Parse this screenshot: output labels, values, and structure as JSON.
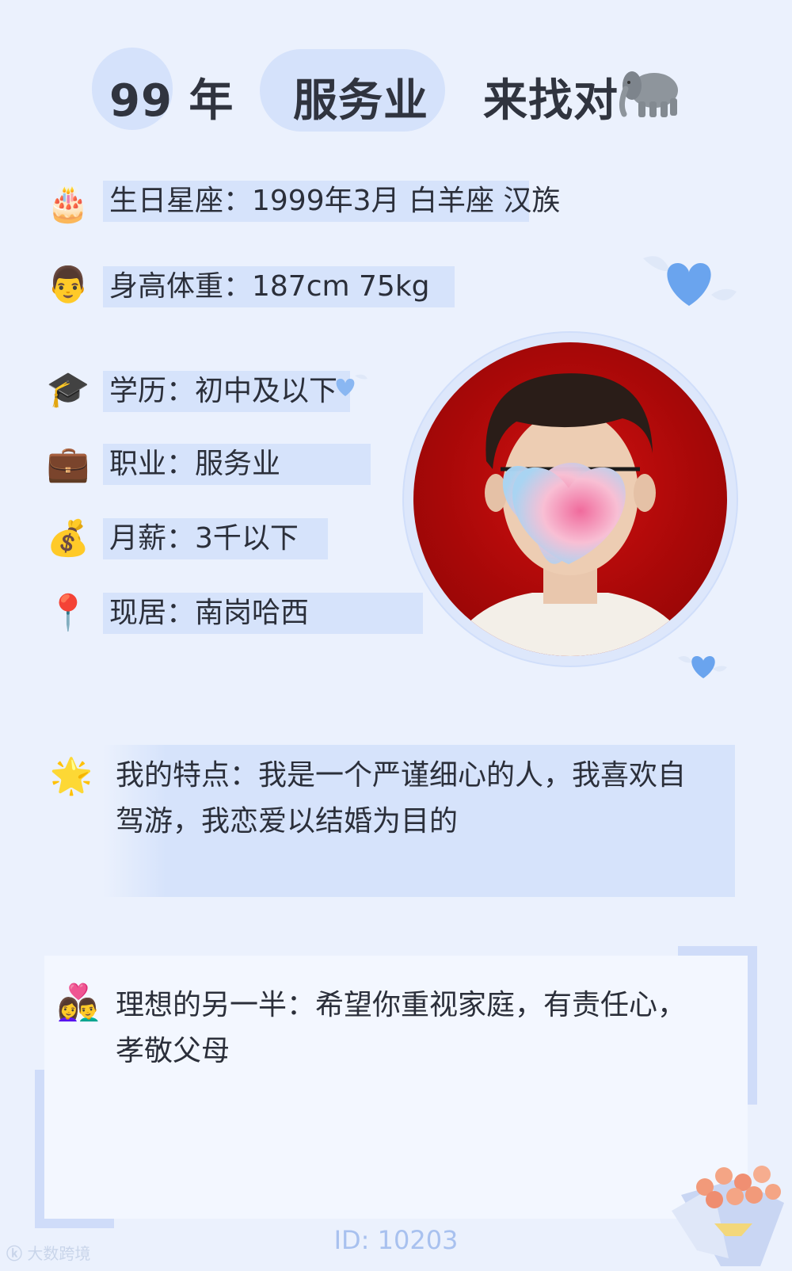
{
  "header": {
    "year": "99 年",
    "job": "服务业",
    "seeking": "来找对",
    "seeking_icon": "elephant-emoji"
  },
  "info": [
    {
      "icon": "🎂",
      "icon_name": "birthday-cake-icon",
      "label": "生日星座：1999年3月 白羊座 汉族"
    },
    {
      "icon": "👨",
      "icon_name": "man-face-icon",
      "label": "身高体重：187cm 75kg"
    },
    {
      "icon": "🎓",
      "icon_name": "graduation-cap-icon",
      "label": "学历：初中及以下"
    },
    {
      "icon": "💼",
      "icon_name": "briefcase-icon",
      "label": "职业：服务业"
    },
    {
      "icon": "💰",
      "icon_name": "money-bag-icon",
      "label": "月薪：3千以下"
    },
    {
      "icon": "📍",
      "icon_name": "location-pin-icon",
      "label": "现居：南岗哈西"
    }
  ],
  "traits": {
    "icon": "🌟",
    "line1": "我的特点：我是一个严谨细心的人，我喜欢自",
    "line2": "驾游，我恋爱以结婚为目的"
  },
  "ideal": {
    "icon": "👩‍❤️‍👨",
    "line1": "理想的另一半：希望你重视家庭，有责任心，",
    "line2": "孝敬父母"
  },
  "footer": {
    "id_text": "ID: 10203",
    "watermark": "大数跨境"
  },
  "colors": {
    "background": "#ebf1fd",
    "highlight": "#d6e3fb",
    "photo_bg": "#b50a0a",
    "heart_blue": "#6aa4ee"
  }
}
